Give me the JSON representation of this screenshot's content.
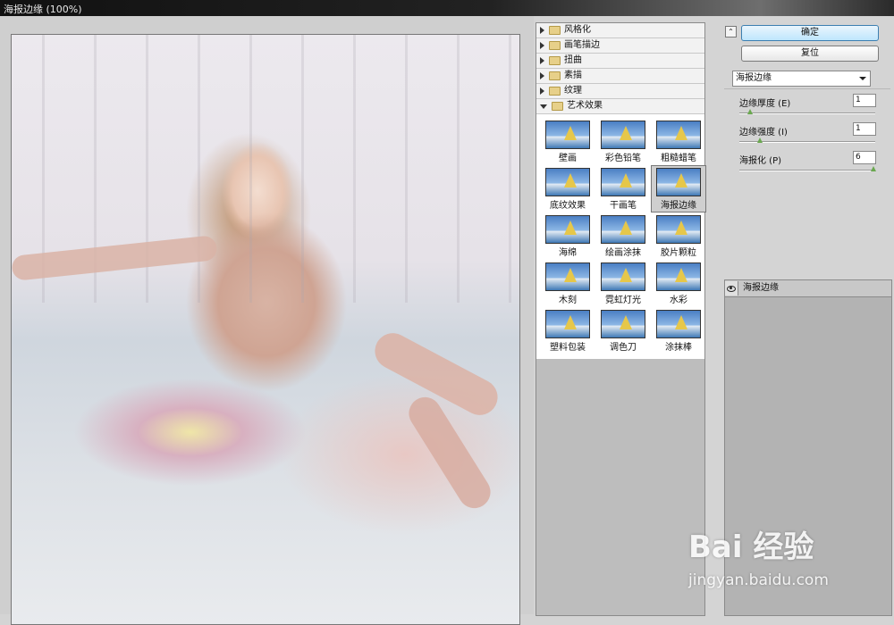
{
  "window": {
    "title": "海报边缘 (100%)"
  },
  "gallery": {
    "categories": [
      {
        "label": "风格化",
        "expanded": false
      },
      {
        "label": "画笔描边",
        "expanded": false
      },
      {
        "label": "扭曲",
        "expanded": false
      },
      {
        "label": "素描",
        "expanded": false
      },
      {
        "label": "纹理",
        "expanded": false
      },
      {
        "label": "艺术效果",
        "expanded": true
      }
    ],
    "thumbnails": [
      "壁画",
      "彩色铅笔",
      "粗糙蜡笔",
      "底纹效果",
      "干画笔",
      "海报边缘",
      "海绵",
      "绘画涂抹",
      "胶片颗粒",
      "木刻",
      "霓虹灯光",
      "水彩",
      "塑料包装",
      "调色刀",
      "涂抹棒"
    ],
    "selected_thumbnail": "海报边缘"
  },
  "side": {
    "collapse_icon": "double-chevron-up-icon",
    "ok_label": "确定",
    "reset_label": "复位",
    "filter_select": "海报边缘",
    "params": [
      {
        "label": "边缘厚度 (E)",
        "value": "1",
        "level": 0.08
      },
      {
        "label": "边缘强度 (I)",
        "value": "1",
        "level": 0.15
      },
      {
        "label": "海报化 (P)",
        "value": "6",
        "level": 1.0
      }
    ],
    "layers": [
      {
        "label": "海报边缘",
        "visible": true
      }
    ]
  },
  "watermark": {
    "text": "Bai 经验",
    "url": "jingyan.baidu.com"
  }
}
